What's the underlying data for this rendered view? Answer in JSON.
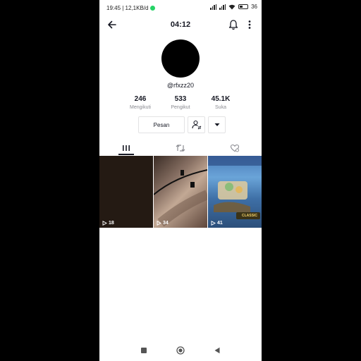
{
  "status": {
    "time_net": "19:45 | 12,1KB/d",
    "battery": "36"
  },
  "header": {
    "title": "04:12"
  },
  "profile": {
    "username": "@rfxzz20",
    "stats": [
      {
        "value": "246",
        "label": "Mengikuti"
      },
      {
        "value": "533",
        "label": "Pengikut"
      },
      {
        "value": "45.1K",
        "label": "Suka"
      }
    ]
  },
  "actions": {
    "message_label": "Pesan"
  },
  "tabs": [
    "videos-tab",
    "reposts-tab",
    "liked-tab"
  ],
  "videos": [
    {
      "views": "18"
    },
    {
      "views": "34"
    },
    {
      "views": "41",
      "badge": "CLASSIC"
    }
  ],
  "icons": {
    "back": "arrow-left-icon",
    "bell": "bell-icon",
    "more": "more-vertical-icon",
    "follow": "person-swap-icon",
    "dropdown": "caret-down-icon",
    "play": "play-icon"
  },
  "colors": {
    "text": "#161823",
    "muted": "#8a8b91",
    "border": "#e3e3e4"
  }
}
